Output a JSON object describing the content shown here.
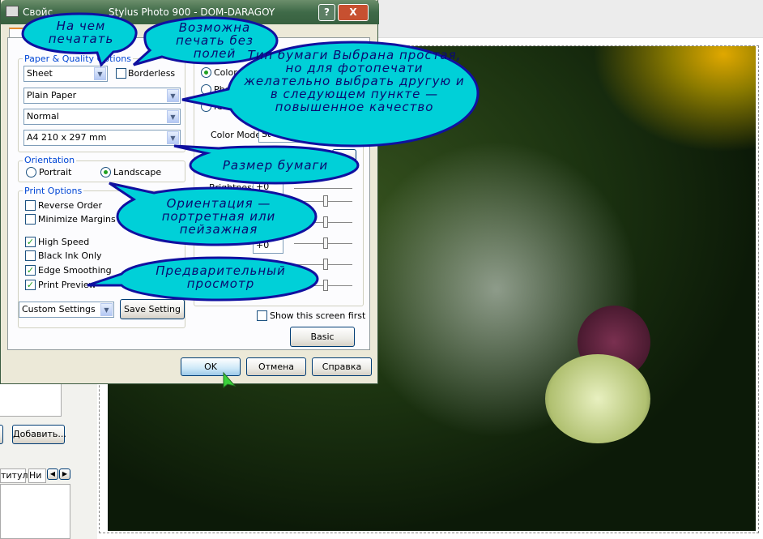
{
  "window": {
    "title_left": "Свойс",
    "title_right": "Stylus Photo 900 - DOM-DARAGOY",
    "help_icon": "?",
    "close_icon": "X"
  },
  "paper_quality": {
    "group_label": "Paper & Quality Options",
    "source": "Sheet",
    "borderless_label": "Borderless",
    "borderless_checked": false,
    "media_type": "Plain Paper",
    "quality": "Normal",
    "size": "A4 210 x 297 mm"
  },
  "orientation": {
    "group_label": "Orientation",
    "portrait": "Portrait",
    "landscape": "Landscape",
    "selected": "Landscape"
  },
  "print_options": {
    "group_label": "Print Options",
    "items": [
      {
        "label": "Reverse Order",
        "checked": false
      },
      {
        "label": "Minimize Margins",
        "checked": false
      },
      {
        "label": "High Speed",
        "checked": true
      },
      {
        "label": "Black Ink Only",
        "checked": false
      },
      {
        "label": "Edge Smoothing",
        "checked": true
      },
      {
        "label": "Print Preview",
        "checked": true
      }
    ]
  },
  "color": {
    "radio_color": "Color C",
    "radio_photo": "Pho",
    "radio_icm": "ICM",
    "color_mode_label": "Color Mode",
    "color_mode_value": "St",
    "brightness_label": "Brightness",
    "brightness_value": "+0",
    "other_value": "+0"
  },
  "custom_settings": "Custom Settings",
  "save_setting": "Save Setting",
  "show_screen_first": "Show this screen first",
  "basic": "Basic",
  "ok": "OK",
  "cancel": "Отмена",
  "help": "Справка",
  "background": {
    "add_button": "Добавить...",
    "tab1": "титул",
    "tab2": "Ни"
  },
  "callouts": {
    "where": "На чем печатать",
    "borderless": "Возможна печать без полей",
    "paper_type": "Тип бумаги Выбрана простая, но для фотопечати желательно выбрать другую и в следующем пункте — повышенное качество",
    "paper_size": "Размер бумаги",
    "orientation": "Ориентация — портретная или пейзажная",
    "preview": "Предварительный просмотр"
  },
  "colors": {
    "callout_fill": "#00d0d8",
    "callout_border": "#1010a0",
    "callout_text": "#0a0a70",
    "titlebar": "#3f6a48"
  }
}
